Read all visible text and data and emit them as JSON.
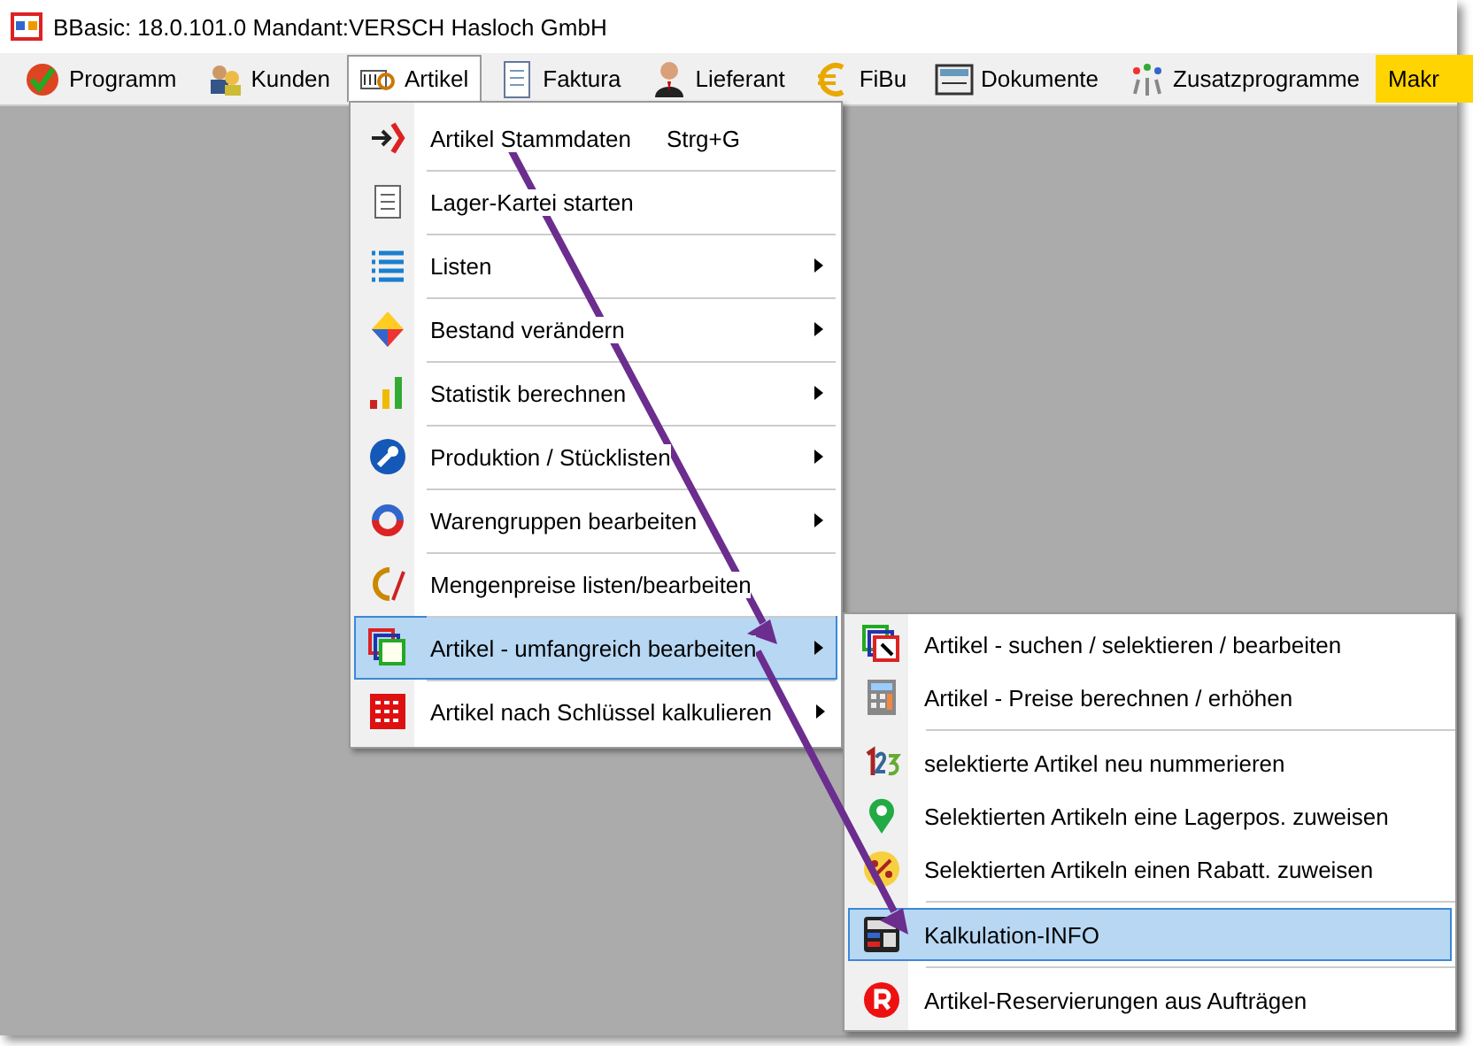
{
  "window": {
    "title": "BBasic: 18.0.101.0 Mandant:VERSCH Hasloch GmbH"
  },
  "menubar": [
    {
      "label": "Programm",
      "selected": false
    },
    {
      "label": "Kunden",
      "selected": false
    },
    {
      "label": "Artikel",
      "selected": true
    },
    {
      "label": "Faktura",
      "selected": false
    },
    {
      "label": "Lieferant",
      "selected": false
    },
    {
      "label": "FiBu",
      "selected": false
    },
    {
      "label": "Dokumente",
      "selected": false
    },
    {
      "label": "Zusatzprogramme",
      "selected": false
    },
    {
      "label": "Makr",
      "selected": false,
      "kind": "highlighted"
    }
  ],
  "menu": {
    "items": [
      {
        "label": "Artikel Stammdaten",
        "shortcut": "Strg+G",
        "submenu": false,
        "selected": false
      },
      {
        "label": "Lager-Kartei starten",
        "submenu": false,
        "selected": false
      },
      {
        "label": "Listen",
        "submenu": true,
        "selected": false
      },
      {
        "label": "Bestand verändern",
        "submenu": true,
        "selected": false
      },
      {
        "label": "Statistik berechnen",
        "submenu": true,
        "selected": false
      },
      {
        "label": "Produktion / Stücklisten",
        "submenu": true,
        "selected": false
      },
      {
        "label": "Warengruppen bearbeiten",
        "submenu": true,
        "selected": false
      },
      {
        "label": "Mengenpreise listen/bearbeiten",
        "submenu": false,
        "selected": false
      },
      {
        "label": "Artikel - umfangreich bearbeiten",
        "submenu": true,
        "selected": true
      },
      {
        "label": "Artikel nach Schlüssel kalkulieren",
        "submenu": true,
        "selected": false
      }
    ]
  },
  "submenu": {
    "groups": [
      [
        {
          "label": "Artikel - suchen / selektieren / bearbeiten",
          "selected": false
        },
        {
          "label": "Artikel  - Preise berechnen / erhöhen",
          "selected": false
        }
      ],
      [
        {
          "label": "selektierte Artikel neu nummerieren",
          "selected": false
        },
        {
          "label": "Selektierten Artikeln eine Lagerpos. zuweisen",
          "selected": false
        },
        {
          "label": "Selektierten Artikeln einen Rabatt. zuweisen",
          "selected": false
        }
      ],
      [
        {
          "label": "Kalkulation-INFO",
          "selected": true
        }
      ],
      [
        {
          "label": "Artikel-Reservierungen aus Aufträgen",
          "selected": false
        }
      ]
    ]
  }
}
